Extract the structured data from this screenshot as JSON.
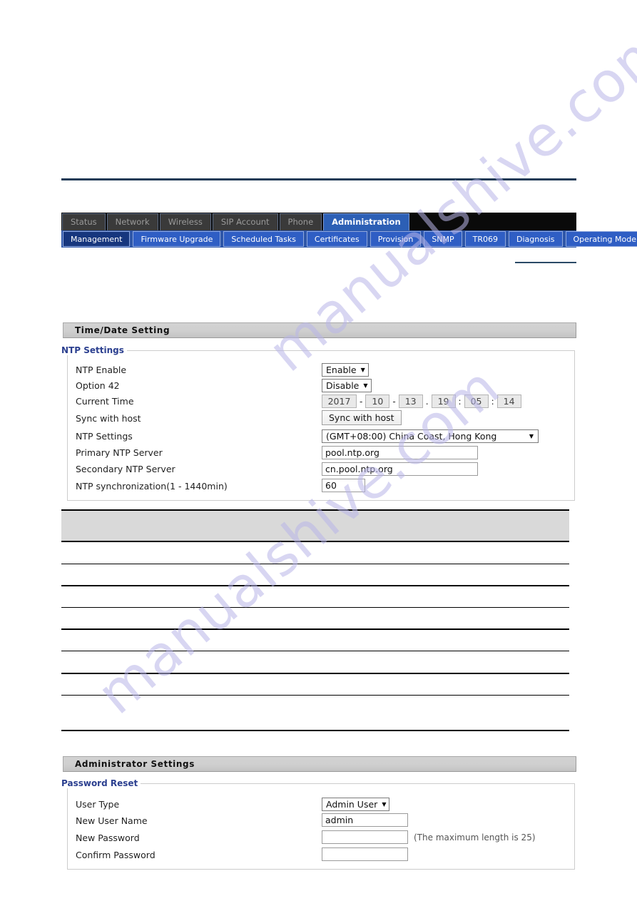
{
  "nav": {
    "main_tabs": [
      {
        "label": "Status",
        "active": false
      },
      {
        "label": "Network",
        "active": false
      },
      {
        "label": "Wireless",
        "active": false
      },
      {
        "label": "SIP Account",
        "active": false
      },
      {
        "label": "Phone",
        "active": false
      },
      {
        "label": "Administration",
        "active": true
      }
    ],
    "sub_tabs": [
      {
        "label": "Management",
        "active": true
      },
      {
        "label": "Firmware Upgrade",
        "active": false
      },
      {
        "label": "Scheduled Tasks",
        "active": false
      },
      {
        "label": "Certificates",
        "active": false
      },
      {
        "label": "Provision",
        "active": false
      },
      {
        "label": "SNMP",
        "active": false
      },
      {
        "label": "TR069",
        "active": false
      },
      {
        "label": "Diagnosis",
        "active": false
      },
      {
        "label": "Operating Mode",
        "active": false
      }
    ]
  },
  "time_date_section": {
    "band_title": "Time/Date Setting",
    "legend": "NTP Settings",
    "rows": {
      "ntp_enable": {
        "label": "NTP Enable",
        "value": "Enable"
      },
      "option42": {
        "label": "Option 42",
        "value": "Disable"
      },
      "current_time": {
        "label": "Current Time",
        "year": "2017",
        "month": "10",
        "day": "13",
        "hour": "19",
        "minute": "05",
        "second": "14",
        "sep_date": "-",
        "sep_datetime": ".",
        "sep_time": ":"
      },
      "sync_with_host": {
        "label": "Sync with host",
        "button": "Sync with host"
      },
      "timezone": {
        "label": "NTP Settings",
        "value": "(GMT+08:00) China Coast, Hong Kong"
      },
      "primary_ntp": {
        "label": "Primary NTP Server",
        "value": "pool.ntp.org"
      },
      "secondary_ntp": {
        "label": "Secondary NTP Server",
        "value": "cn.pool.ntp.org"
      },
      "ntp_sync_interval": {
        "label": "NTP synchronization(1 - 1440min)",
        "value": "60"
      }
    }
  },
  "admin_section": {
    "band_title": "Administrator Settings",
    "legend": "Password Reset",
    "rows": {
      "user_type": {
        "label": "User Type",
        "value": "Admin User"
      },
      "new_user_name": {
        "label": "New User Name",
        "value": "admin"
      },
      "new_password": {
        "label": "New Password",
        "value": "",
        "hint": "(The maximum length is 25)"
      },
      "confirm_password": {
        "label": "Confirm Password",
        "value": ""
      }
    }
  },
  "icons": {
    "dropdown_caret": "▼"
  },
  "watermark": {
    "line_a": "manualshive.com",
    "line_b": "manualshive.com"
  },
  "colors": {
    "accent_navy": "#1f3a56",
    "tab_active_blue": "#2c5fb5",
    "subtab_blue": "#2f5ec4",
    "subtab_active_blue": "#16367e",
    "legend_blue": "#2b3f8f",
    "band_gray": "#cfcfcf"
  }
}
